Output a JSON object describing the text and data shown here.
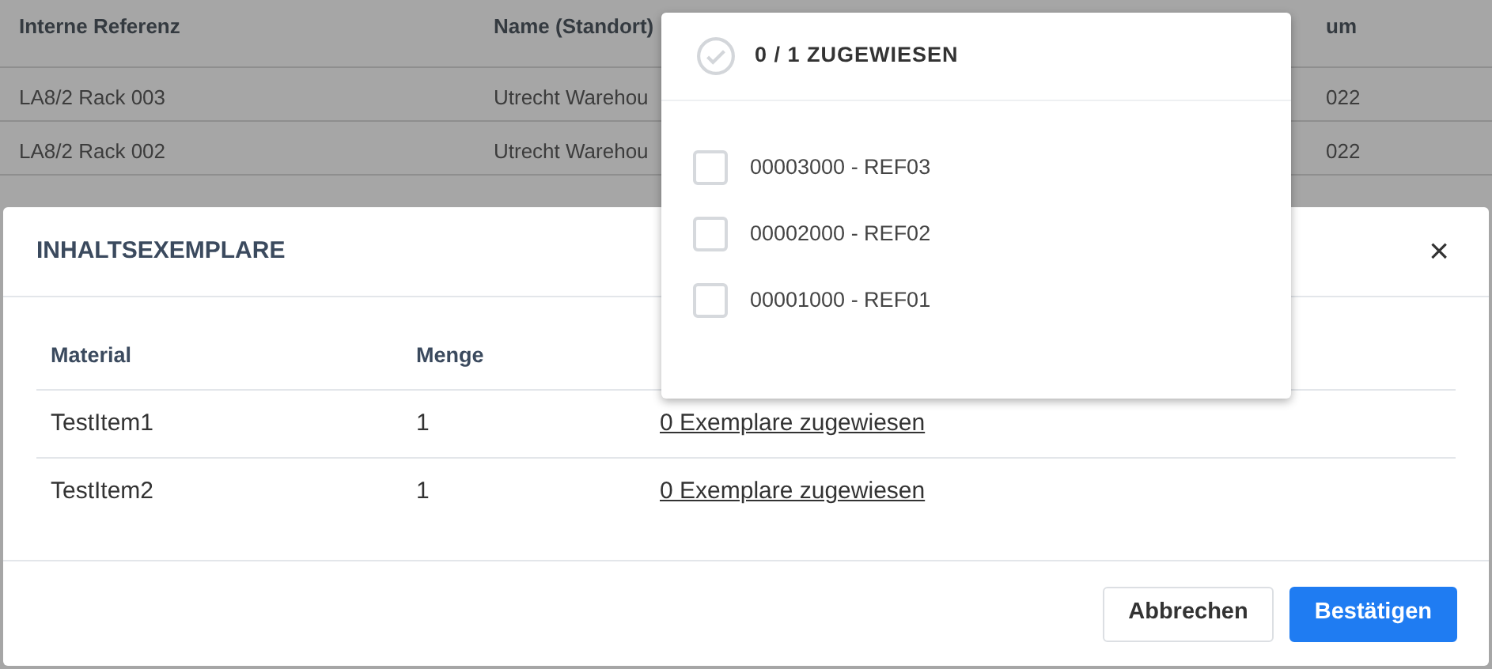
{
  "background_table": {
    "columns": [
      "Interne Referenz",
      "Name (Standort)",
      "um"
    ],
    "rows": [
      [
        "LA8/2 Rack 003",
        "Utrecht Warehou",
        "022"
      ],
      [
        "LA8/2 Rack 002",
        "Utrecht Warehou",
        "022"
      ]
    ]
  },
  "modal": {
    "title": "INHALTSEXEMPLARE",
    "close": "×",
    "table": {
      "columns": [
        "Material",
        "Menge"
      ],
      "rows": [
        {
          "material": "TestItem1",
          "menge": "1",
          "link": "0 Exemplare zugewiesen"
        },
        {
          "material": "TestItem2",
          "menge": "1",
          "link": "0 Exemplare zugewiesen"
        }
      ]
    },
    "buttons": [
      {
        "label": "Abbrechen",
        "kind": "secondary"
      },
      {
        "label": "Bestätigen",
        "kind": "primary"
      }
    ]
  },
  "popover": {
    "title": "0 / 1 ZUGEWIESEN",
    "items": [
      {
        "label": "00003000 - REF03",
        "checked": false
      },
      {
        "label": "00002000 - REF02",
        "checked": false
      },
      {
        "label": "00001000 - REF01",
        "checked": false
      }
    ]
  }
}
